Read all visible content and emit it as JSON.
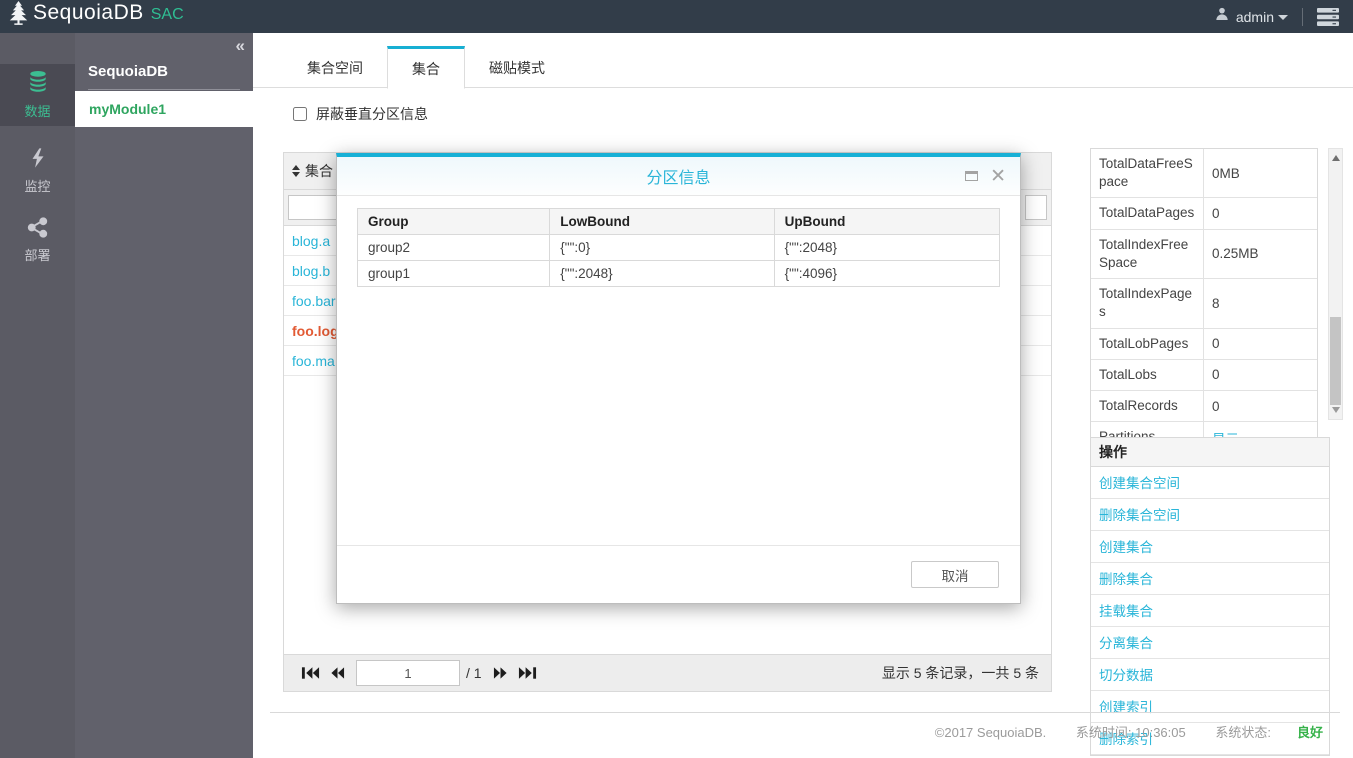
{
  "colors": {
    "accent_cyan": "#29b5d8",
    "brand_teal": "#2fbe93",
    "highlight_orange": "#e25a34",
    "status_green": "#36b24a",
    "tab_active_border": "#17afd3"
  },
  "topbar": {
    "logo_text": "SequoiaDB",
    "logo_badge": "SAC",
    "user": "admin"
  },
  "rail": {
    "items": [
      {
        "label": "数据",
        "icon": "database-icon",
        "active": true
      },
      {
        "label": "监控",
        "icon": "lightning-icon",
        "active": false
      },
      {
        "label": "部署",
        "icon": "share-icon",
        "active": false
      }
    ]
  },
  "sidebar": {
    "title": "SequoiaDB",
    "module": "myModule1"
  },
  "tabs": {
    "tab1": "集合空间",
    "tab2": "集合",
    "tab3": "磁贴模式"
  },
  "filter_checkbox": {
    "label": "屏蔽垂直分区信息",
    "checked": false
  },
  "collection_table": {
    "sort_header": "集合",
    "filter_value": "",
    "rows": [
      {
        "name": "blog.a",
        "highlight": false
      },
      {
        "name": "blog.b",
        "highlight": false
      },
      {
        "name": "foo.bar",
        "highlight": false
      },
      {
        "name": "foo.log",
        "highlight": true
      },
      {
        "name": "foo.ma",
        "highlight": false
      }
    ]
  },
  "pagination": {
    "current_page": "1",
    "total_pages": "/ 1",
    "summary": "显示 5 条记录，一共 5 条"
  },
  "modal": {
    "title": "分区信息",
    "headers": [
      "Group",
      "LowBound",
      "UpBound"
    ],
    "rows": [
      [
        "group2",
        "{\"\":0}",
        "{\"\":2048}"
      ],
      [
        "group1",
        "{\"\":2048}",
        "{\"\":4096}"
      ]
    ],
    "cancel_label": "取消"
  },
  "stats_table": {
    "rows": [
      {
        "label": "TotalDataFreeSpace",
        "value": "0MB",
        "link": false
      },
      {
        "label": "TotalDataPages",
        "value": "0",
        "link": false
      },
      {
        "label": "TotalIndexFreeSpace",
        "value": "0.25MB",
        "link": false
      },
      {
        "label": "TotalIndexPages",
        "value": "8",
        "link": false
      },
      {
        "label": "TotalLobPages",
        "value": "0",
        "link": false
      },
      {
        "label": "TotalLobs",
        "value": "0",
        "link": false
      },
      {
        "label": "TotalRecords",
        "value": "0",
        "link": false
      },
      {
        "label": "Partitions",
        "value": "显示",
        "link": true
      }
    ]
  },
  "operations": {
    "header": "操作",
    "items": [
      "创建集合空间",
      "删除集合空间",
      "创建集合",
      "删除集合",
      "挂载集合",
      "分离集合",
      "切分数据",
      "创建索引",
      "删除索引"
    ]
  },
  "footer": {
    "copyright": "©2017 SequoiaDB.",
    "system_time": "系统时间: 10:36:05",
    "system_status_label": "系统状态:",
    "system_status_value": "良好"
  }
}
